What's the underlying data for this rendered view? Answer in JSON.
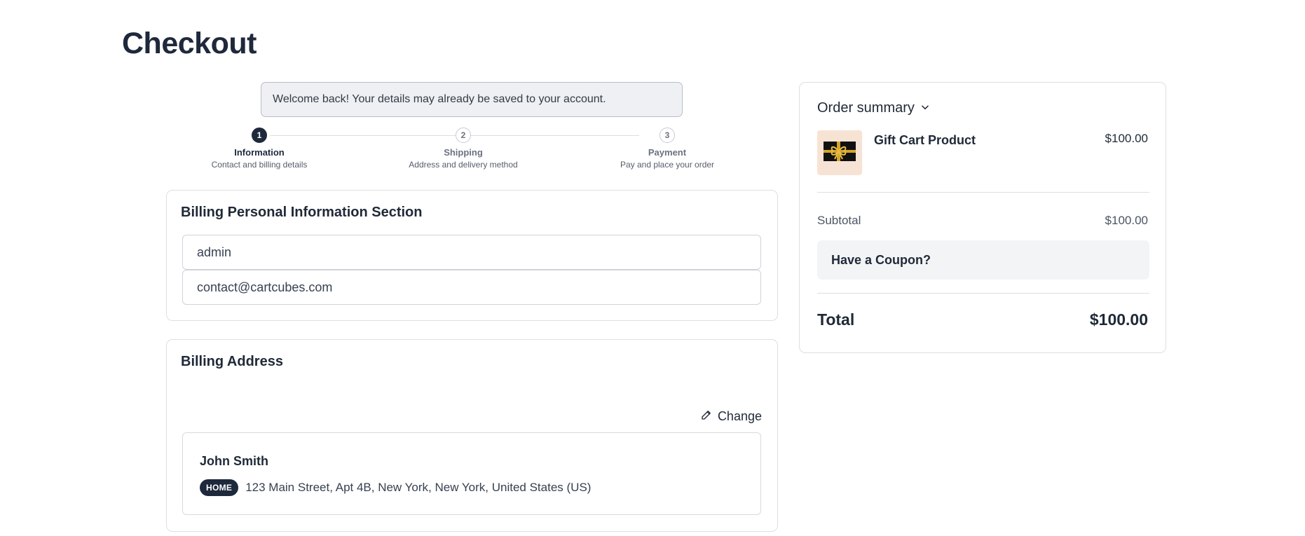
{
  "page": {
    "title": "Checkout"
  },
  "welcome": {
    "message": "Welcome back! Your details may already be saved to your account."
  },
  "steps": [
    {
      "number": "1",
      "title": "Information",
      "subtitle": "Contact and billing details",
      "active": true
    },
    {
      "number": "2",
      "title": "Shipping",
      "subtitle": "Address and delivery method",
      "active": false
    },
    {
      "number": "3",
      "title": "Payment",
      "subtitle": "Pay and place your order",
      "active": false
    }
  ],
  "personal": {
    "title": "Billing Personal Information Section",
    "name_value": "admin",
    "email_value": "contact@cartcubes.com"
  },
  "billing_address": {
    "title": "Billing Address",
    "change_label": "Change",
    "name": "John Smith",
    "badge": "HOME",
    "address": "123 Main Street, Apt 4B, New York, New York, United States (US)"
  },
  "summary": {
    "title": "Order summary",
    "product_name": "Gift Cart Product",
    "product_price": "$100.00",
    "subtotal_label": "Subtotal",
    "subtotal_value": "$100.00",
    "coupon_label": "Have a Coupon?",
    "total_label": "Total",
    "total_value": "$100.00"
  },
  "colors": {
    "primary": "#1e293b",
    "border": "#dcdfe4",
    "product_bg": "#f7e3d4"
  },
  "icons": {
    "change": "pencil-icon",
    "summary_toggle": "chevron-down-icon",
    "product": "gift-card-icon"
  }
}
